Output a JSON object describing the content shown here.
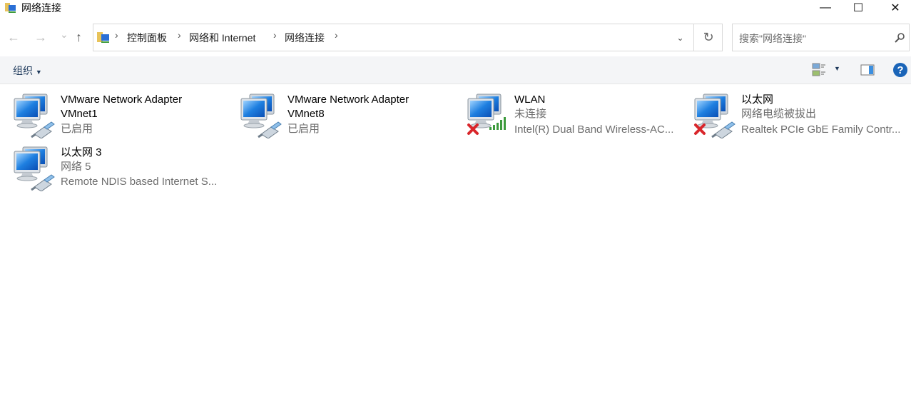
{
  "window": {
    "title": "网络连接",
    "minimize": "—",
    "maximize": "☐",
    "close": "✕"
  },
  "nav": {
    "back": "←",
    "forward": "→",
    "recent": "⌄",
    "up": "↑"
  },
  "breadcrumb": [
    "控制面板",
    "网络和 Internet",
    "网络连接"
  ],
  "search": {
    "placeholder": "搜索\"网络连接\""
  },
  "toolbar": {
    "organize": "组织"
  },
  "connections": [
    {
      "name": "VMware Network Adapter VMnet1",
      "name1": "VMware Network Adapter",
      "name2": "VMnet1",
      "status": "已启用",
      "type": "ethernet",
      "disconnected": false
    },
    {
      "name": "VMware Network Adapter VMnet8",
      "name1": "VMware Network Adapter",
      "name2": "VMnet8",
      "status": "已启用",
      "type": "ethernet",
      "disconnected": false
    },
    {
      "name": "WLAN",
      "status": "未连接",
      "device": "Intel(R) Dual Band Wireless-AC...",
      "type": "wireless",
      "disconnected": true
    },
    {
      "name": "以太网",
      "status": "网络电缆被拔出",
      "device": "Realtek PCIe GbE Family Contr...",
      "type": "ethernet",
      "disconnected": true
    },
    {
      "name": "以太网 3",
      "status": "网络 5",
      "device": "Remote NDIS based Internet S...",
      "type": "ethernet",
      "disconnected": false
    }
  ],
  "colors": {
    "toolbar_bg": "#f4f5f7",
    "organize_text": "#1e395b",
    "help_blue": "#1a64b8"
  }
}
